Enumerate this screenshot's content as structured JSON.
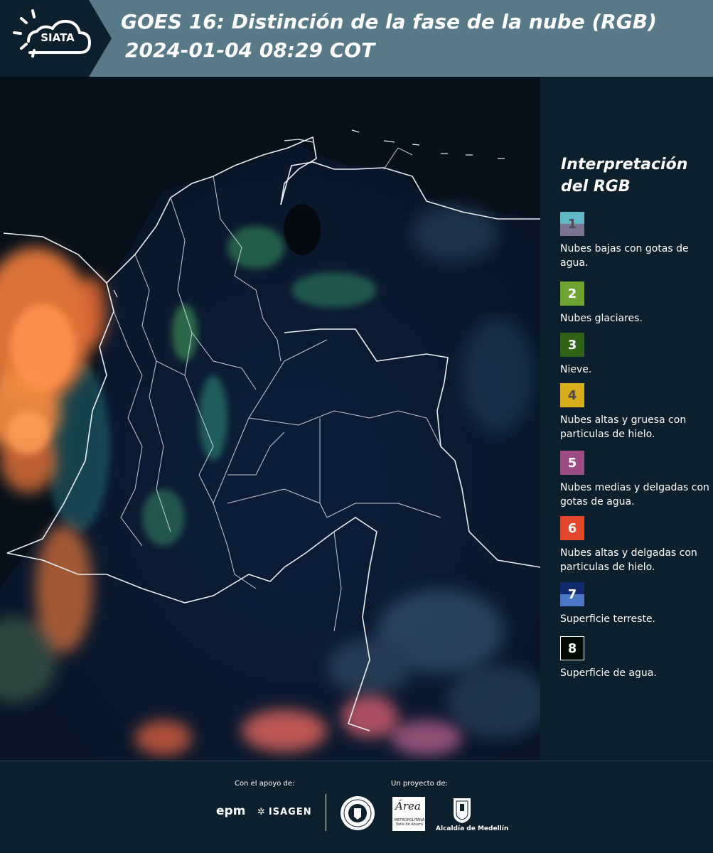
{
  "header": {
    "logo_text": "SIATA",
    "title_line1": "GOES 16: Distinción de la fase de la nube (RGB)",
    "title_line2": "2024-01-04 08:29 COT"
  },
  "legend": {
    "title": "Interpretación del RGB",
    "items": [
      {
        "number": "1",
        "label": "Nubes bajas con gotas de agua.",
        "color_top": "#62b7c4",
        "color_bottom": "#7a7490",
        "num_color": "#4a4a5a"
      },
      {
        "number": "2",
        "label": "Nubes glaciares.",
        "color": "#6da530",
        "num_color": "#ffffff"
      },
      {
        "number": "3",
        "label": "Nieve.",
        "color": "#2f6418",
        "num_color": "#ffffff"
      },
      {
        "number": "4",
        "label": "Nubes altas y gruesa con particulas de hielo.",
        "color": "#d9ad1c",
        "num_color": "#4a4a4a"
      },
      {
        "number": "5",
        "label": "Nubes medias y delgadas con gotas de agua.",
        "color": "#9c4b84",
        "num_color": "#ffffff"
      },
      {
        "number": "6",
        "label": "Nubes altas y delgadas con particulas de hielo.",
        "color": "#e1482a",
        "num_color": "#ffffff"
      },
      {
        "number": "7",
        "label": "Superficie terreste.",
        "color_top": "#0f2a6e",
        "color_bottom": "#4b78c6",
        "num_color": "#ffffff"
      },
      {
        "number": "8",
        "label": "Superficie de agua.",
        "color": "#040d05",
        "num_color": "#ffffff",
        "border": "#ffffff"
      }
    ]
  },
  "footer": {
    "support_label": "Con el apoyo de:",
    "project_label": "Un proyecto de:",
    "epm_text": "epm",
    "isagen_text": "ISAGEN",
    "area_script": "Área",
    "area_sub": "METROPOLITANA Valle de Aburrá",
    "alcaldia_text": "Alcaldía de Medellín"
  }
}
